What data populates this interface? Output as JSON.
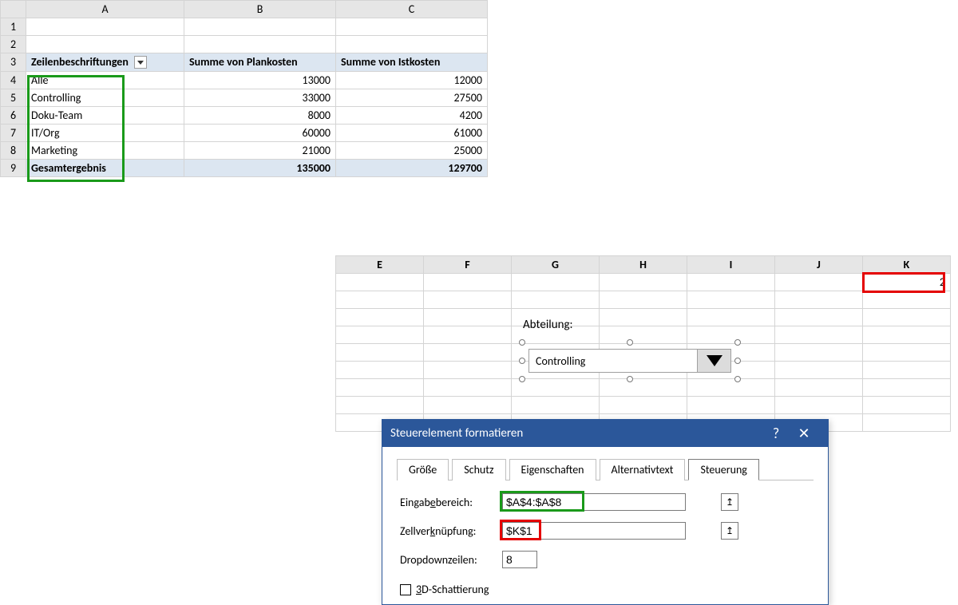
{
  "topSheet": {
    "cols": [
      "A",
      "B",
      "C"
    ],
    "rows": [
      "1",
      "2",
      "3",
      "4",
      "5",
      "6",
      "7",
      "8",
      "9"
    ],
    "header": {
      "a": "Zeilenbeschriftungen",
      "b": "Summe von Plankosten",
      "c": "Summe von Istkosten"
    },
    "data": [
      {
        "a": "Alle",
        "b": "13000",
        "c": "12000"
      },
      {
        "a": "Controlling",
        "b": "33000",
        "c": "27500"
      },
      {
        "a": "Doku-Team",
        "b": "8000",
        "c": "4200"
      },
      {
        "a": "IT/Org",
        "b": "60000",
        "c": "61000"
      },
      {
        "a": "Marketing",
        "b": "21000",
        "c": "25000"
      }
    ],
    "total": {
      "a": "Gesamtergebnis",
      "b": "135000",
      "c": "129700"
    }
  },
  "bottomSheet": {
    "cols": [
      "E",
      "F",
      "G",
      "H",
      "I",
      "J",
      "K"
    ],
    "k1": "2"
  },
  "comboLabel": "Abteilung:",
  "comboValue": "Controlling",
  "dialog": {
    "title": "Steuerelement formatieren",
    "help": "?",
    "close": "✕",
    "tabs": [
      "Größe",
      "Schutz",
      "Eigenschaften",
      "Alternativtext",
      "Steuerung"
    ],
    "activeTab": 4,
    "fields": {
      "input_label_pre": "Eingab",
      "input_label_u": "e",
      "input_label_post": "bereich:",
      "inputRange": "$A$4:$A$8",
      "link_label_pre": "Zellver",
      "link_label_u": "k",
      "link_label_post": "nüpfung:",
      "cellLink": "$K$1",
      "drop_label": "Dropdownzeilen:",
      "dropLines": "8",
      "shade_pre": "",
      "shade_u": "3",
      "shade_post": "D-Schattierung"
    },
    "refIcon": "↥"
  }
}
